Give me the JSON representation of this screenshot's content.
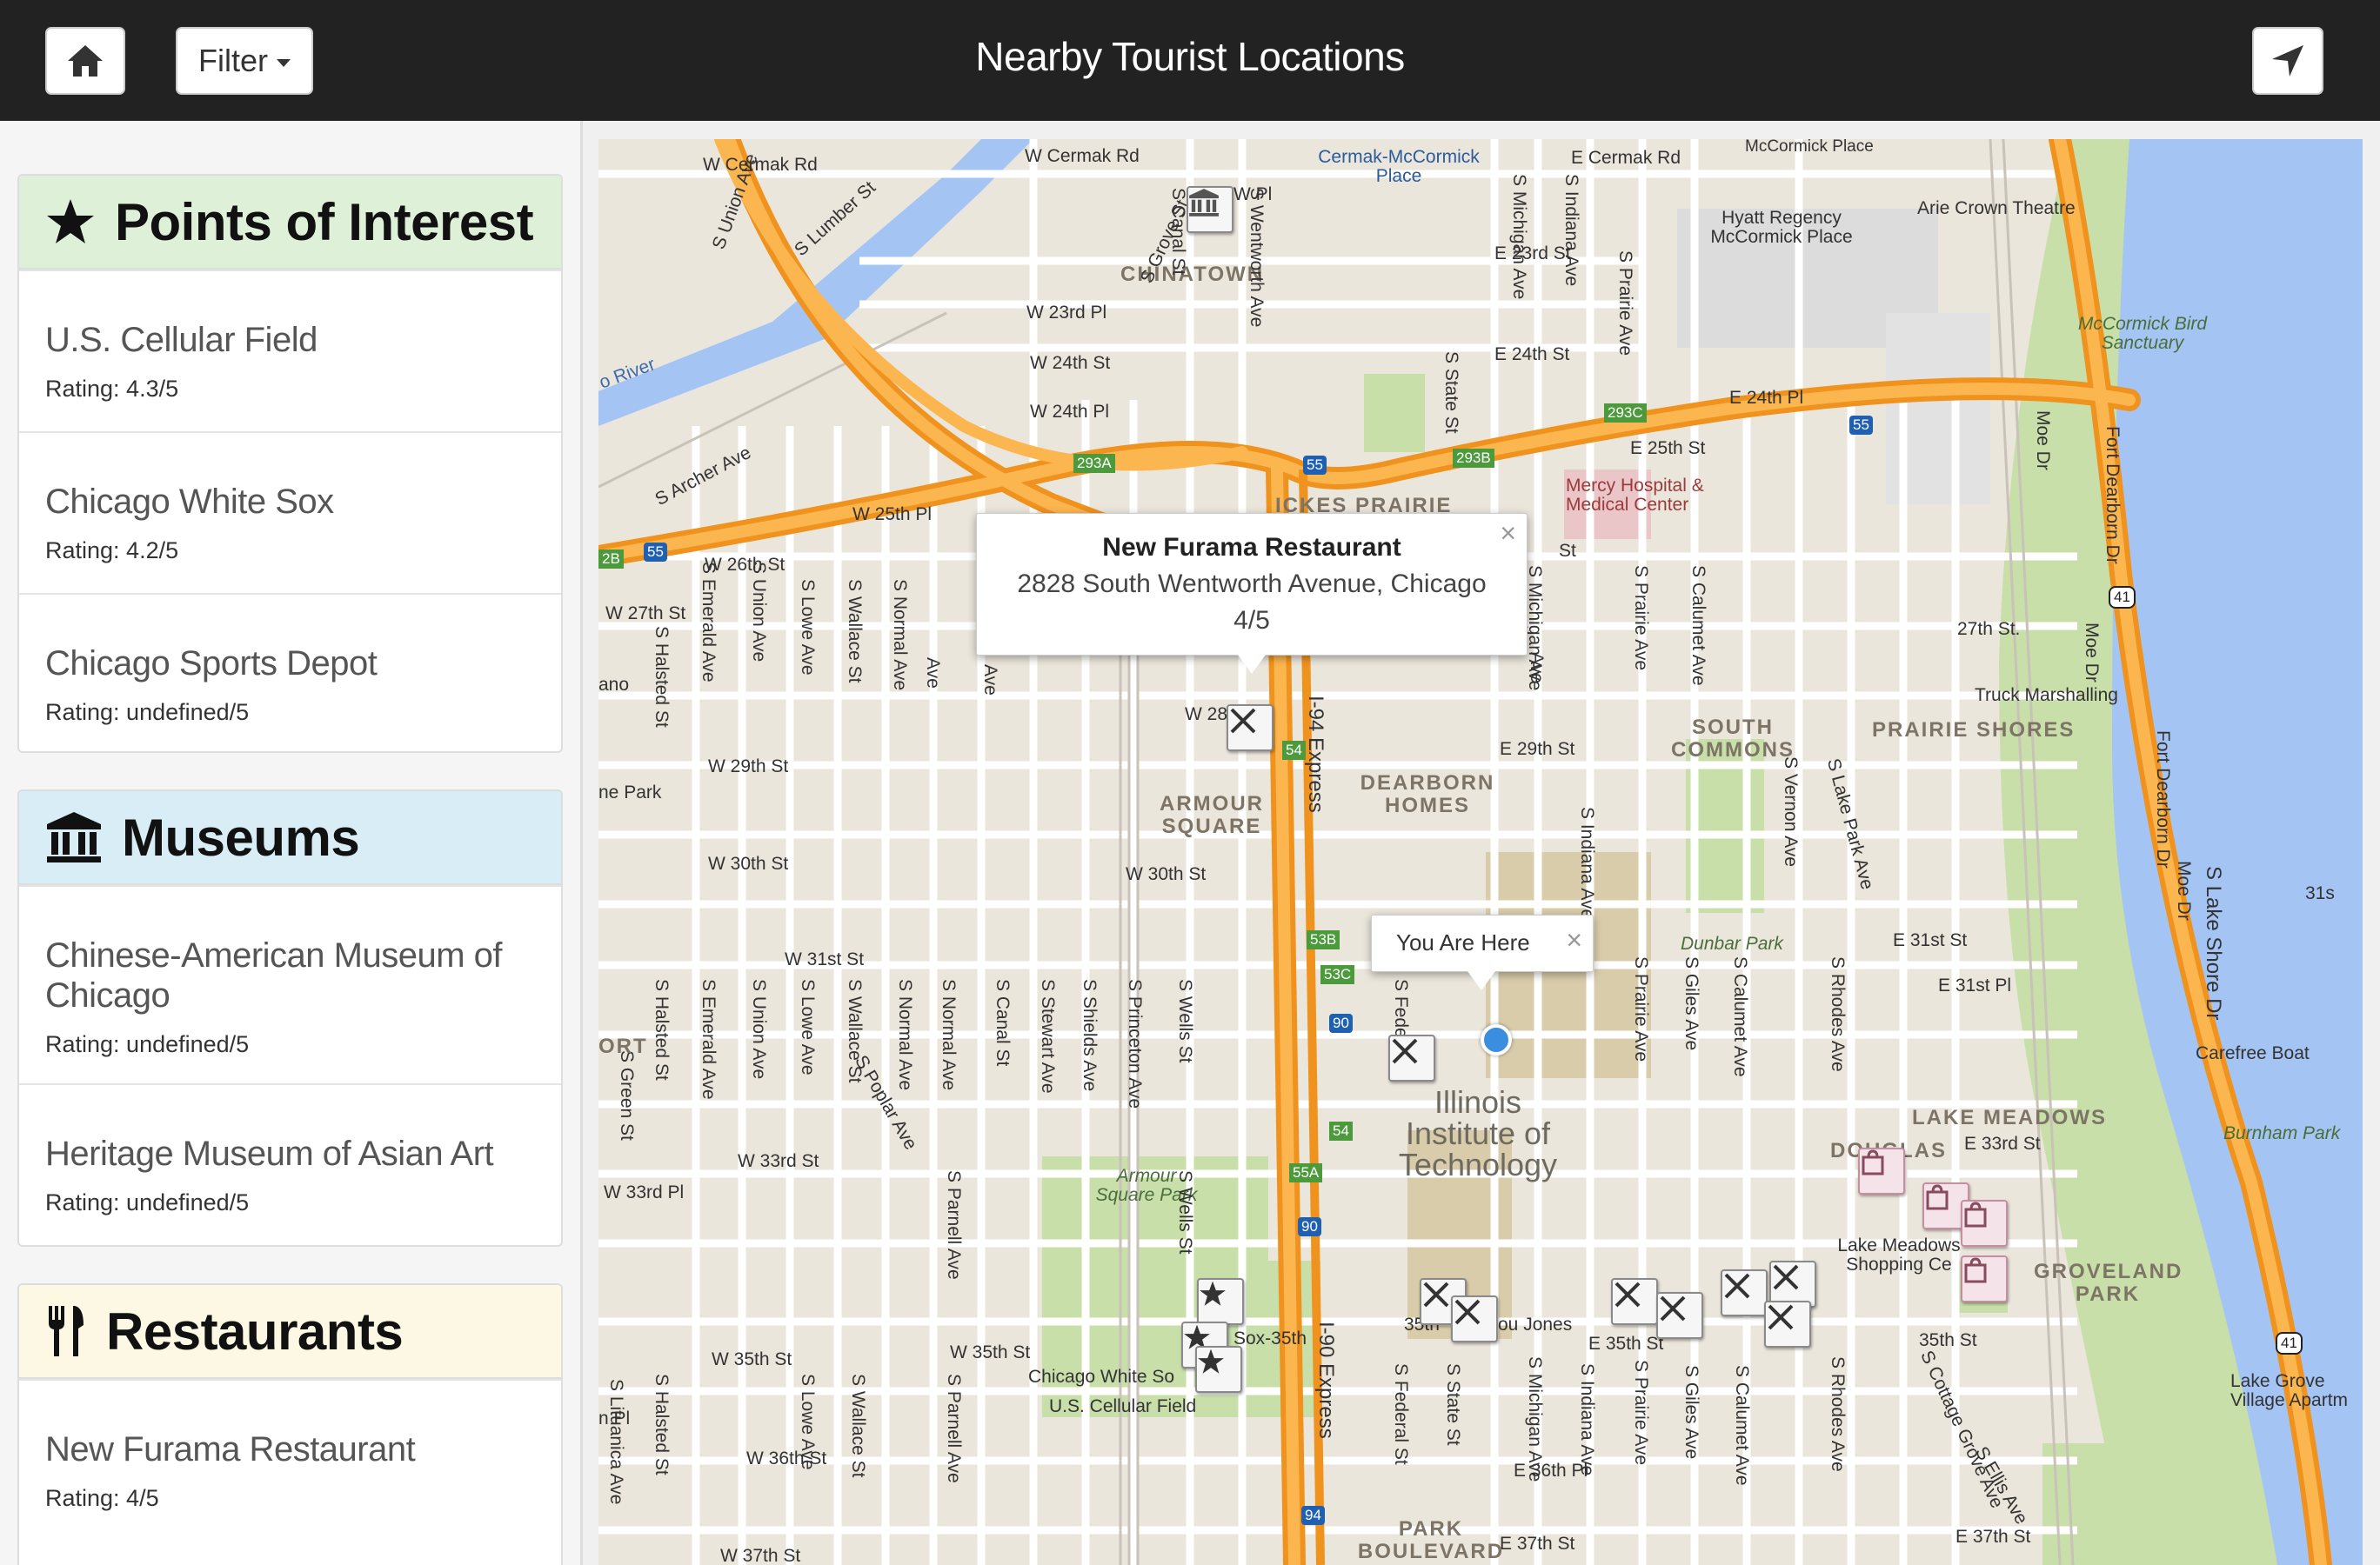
{
  "header": {
    "title": "Nearby Tourist Locations",
    "filter_label": "Filter"
  },
  "sidebar": {
    "points_of_interest": {
      "title": "Points of Interest",
      "items": [
        {
          "name": "U.S. Cellular Field",
          "rating": "Rating: 4.3/5"
        },
        {
          "name": "Chicago White Sox",
          "rating": "Rating: 4.2/5"
        },
        {
          "name": "Chicago Sports Depot",
          "rating": "Rating: undefined/5"
        }
      ]
    },
    "museums": {
      "title": "Museums",
      "items": [
        {
          "name": "Chinese-American Museum of Chicago",
          "rating": "Rating: undefined/5"
        },
        {
          "name": "Heritage Museum of Asian Art",
          "rating": "Rating: undefined/5"
        }
      ]
    },
    "restaurants": {
      "title": "Restaurants",
      "items": [
        {
          "name": "New Furama Restaurant",
          "rating": "Rating: 4/5"
        }
      ]
    }
  },
  "map": {
    "info_window": {
      "title": "New Furama Restaurant",
      "address": "2828 South Wentworth Avenue, Chicago",
      "rating": "4/5",
      "close": "×"
    },
    "you_are_here": {
      "label": "You Are Here",
      "close": "×"
    },
    "labels": {
      "cermak_rd_w": "W Cermak Rd",
      "cermak_rd_w2": "W Cermak Rd",
      "cermak_rd_e": "E Cermak Rd",
      "cermak_place": "Cermak-McCormick Place",
      "chinatown": "CHINATOWN",
      "hyatt": "Hyatt Regency McCormick Place",
      "arie_crown": "Arie Crown Theatre",
      "mccormick_bird": "McCormick Bird Sanctuary",
      "w23rd_pl": "W 23rd Pl",
      "w24th_st": "W 24th St",
      "w24th_pl": "W 24th Pl",
      "e23rd_st": "E 23rd St",
      "e24th_st": "E 24th St",
      "e24th_pl": "E 24th Pl",
      "e25th_st": "E 25th St",
      "w25th_pl": "W 25th Pl",
      "w26th_st": "W 26th St",
      "w27th_st": "W 27th St",
      "w28th": "W 28th",
      "w29th_st": "W 29th St",
      "e29th_st": "E 29th St",
      "w30th_st": "W 30th St",
      "w30th_st2": "W 30th St",
      "w31st_st": "W 31st St",
      "e31st_st": "E 31st St",
      "e31st_pl": "E 31st Pl",
      "w33rd_st": "W 33rd St",
      "w33rd_pl": "W 33rd Pl",
      "e33rd_st": "E 33rd St",
      "w35th_st": "W 35th St",
      "w35th_st2": "W 35th St",
      "e35th_st": "E 35th St",
      "w36th_st": "W 36th St",
      "e36th_pl": "E 36th Pl",
      "w37th_st": "W 37th St",
      "e37th_st": "E 37th St",
      "e37th_st2": "E 37th St",
      "mercy": "Mercy Hospital & Medical Center",
      "armour_square": "ARMOUR SQUARE",
      "dearborn_homes": "DEARBORN HOMES",
      "south_commons": "SOUTH COMMONS",
      "prairie_shores": "PRAIRIE SHORES",
      "lake_meadows": "LAKE MEADOWS",
      "groveland_park": "GROVELAND PARK",
      "douglas": "DOUGLAS",
      "park_boulevard": "PARK BOULEVARD",
      "ickes_prairie": "ICKES PRAIRIE",
      "iit": "Illinois Institute of Technology",
      "armour_square_park": "Armour Square Park",
      "chicago_white_sox": "Chicago White So",
      "us_cellular": "U.S. Cellular Field",
      "sox35th": "Sox-35th",
      "st_27th": "27th St.",
      "truck_marshalling": "Truck Marshalling",
      "dunbar_park": "Dunbar Park",
      "lake_meadows_shopping": "Lake Meadows Shopping Ce",
      "carefree_boat": "Carefree Boat",
      "burnham_park": "Burnham Park",
      "lake_grove": "Lake Grove Village Apartm",
      "lou_jones": "ou Jones",
      "st35th_short": "35th",
      "st35th_e2": "35th St",
      "w31s": "31s",
      "river": "o River",
      "s_archer": "S Archer Ave",
      "s_union": "S Union Ave",
      "s_lumber": "S Lumber St",
      "s_grove": "S Grove St",
      "s_canal": "S Canal St",
      "s_wentworth": "S Wentworth Ave",
      "s_michigan": "S Michigan Ave",
      "s_indiana": "S Indiana Ave",
      "s_prairie": "S Prairie Ave",
      "s_state": "S State St",
      "fort_dearborn": "Fort Dearborn Dr",
      "s_lake_shore": "S Lake Shore Dr",
      "moe_dr": "Moe Dr",
      "i94": "I-94 Express",
      "i90": "I-90 Express",
      "s_halsted": "S Halsted St",
      "s_emerald": "S Emerald Ave",
      "s_lowe": "S Lowe Ave",
      "s_wallace": "S Wallace St",
      "s_normal": "S Normal Ave",
      "s_stewart": "S Stewart Ave",
      "s_shields": "S Shields Ave",
      "s_princeton": "S Princeton Ave",
      "s_wells": "S Wells St",
      "s_federal": "S Federal St",
      "s_giles": "S Giles Ave",
      "s_calumet": "S Calumet Ave",
      "s_rhodes": "S Rhodes Ave",
      "s_vernon": "S Vernon Ave",
      "s_lake_park": "S Lake Park Ave",
      "s_cottage": "S Cottage Grove Ave",
      "s_ellis": "S Ellis Ave",
      "s_parnell": "S Parnell Ave",
      "s_poplar": "S Poplar Ave",
      "s_green": "S Green St",
      "s_lituanica": "S Lituanica Ave",
      "ne_park": "ne Park",
      "ano": "ano",
      "ort": "ORT",
      "n_pl": "n Pl",
      "w_pl": "W Pl",
      "ave_short": "Ave",
      "st_short": "St",
      "mccormick_pl_top": "McCormick Place",
      "b_293a": "293A",
      "b_293b": "293B",
      "b_293c": "293C",
      "b_53b": "53B",
      "b_53c": "53C",
      "b_54": "54",
      "b_54b": "54",
      "b_55a": "55A",
      "b_55": "55",
      "b_55b": "55",
      "b_55c": "55",
      "b_90": "90",
      "b_90b": "90",
      "b_94": "94",
      "b_41": "41",
      "b_41b": "41",
      "b_2b": "2B"
    }
  },
  "colors": {
    "navbar": "#222222",
    "poi_header": "#dff0d8",
    "museum_header": "#d9edf7",
    "restaurant_header": "#fcf8e3",
    "highway": "#f9a13a",
    "water": "#a4c4f4",
    "park": "#c8dfaa"
  },
  "icons": {
    "home": "home-icon",
    "filter_caret": "caret-down-icon",
    "locate": "location-arrow-icon",
    "poi": "star-icon",
    "museum": "bank-icon",
    "restaurant": "cutlery-icon"
  }
}
